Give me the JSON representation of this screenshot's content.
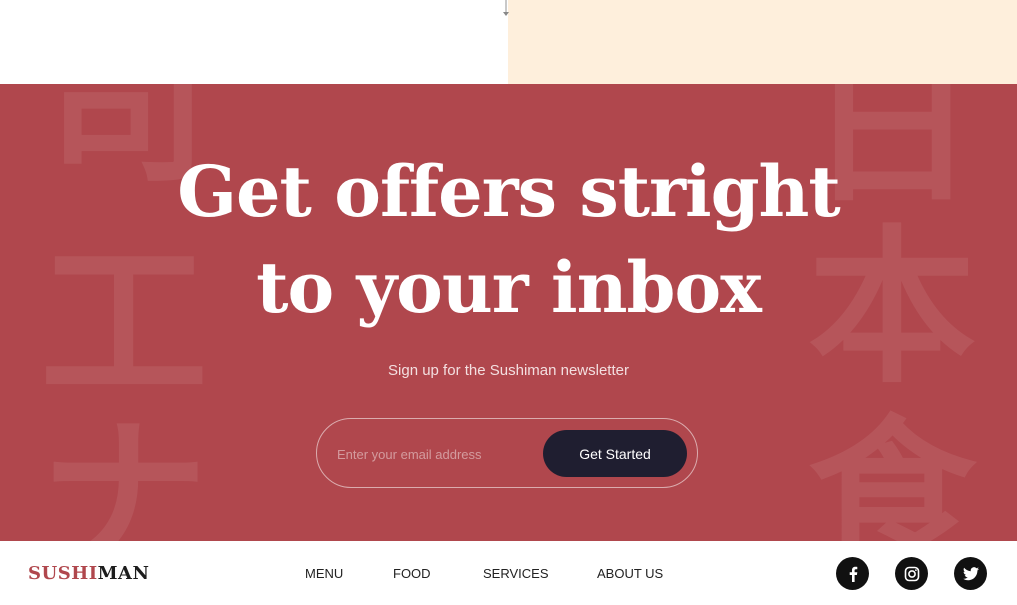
{
  "newsletter": {
    "headline_line1": "Get offers stright",
    "headline_line2": "to your inbox",
    "subtitle": "Sign up for the Sushiman newsletter",
    "email_placeholder": "Enter your email address",
    "cta_label": "Get Started",
    "background_kanji": [
      "司",
      "工",
      "ナ",
      "日",
      "本",
      "食"
    ]
  },
  "footer": {
    "logo_part1": "SUSHI",
    "logo_part2": "MAN",
    "nav": [
      "MENU",
      "FOOD",
      "SERVICES",
      "ABOUT US"
    ],
    "social": [
      "facebook-icon",
      "instagram-icon",
      "twitter-icon"
    ]
  },
  "colors": {
    "top_right_bg": "#feefdc",
    "newsletter_bg": "#b0474d",
    "cta_bg": "#1f1e30",
    "logo_accent": "#b0474d",
    "social_bg": "#111111"
  }
}
